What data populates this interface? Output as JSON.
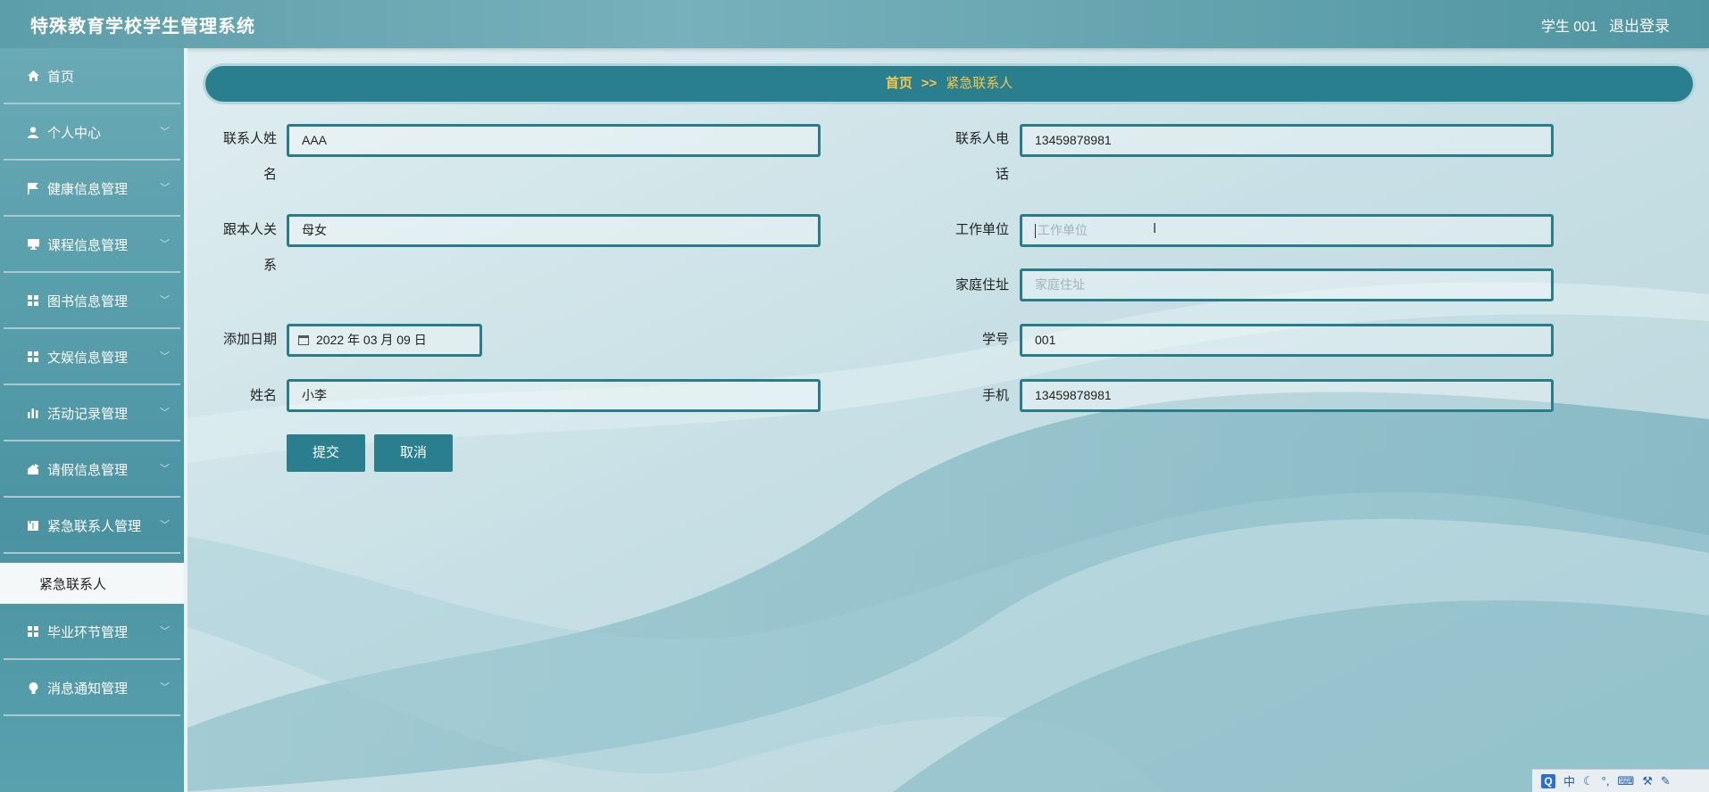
{
  "header": {
    "title": "特殊教育学校学生管理系统",
    "user": "学生  001",
    "logout": "退出登录"
  },
  "sidebar": {
    "items": [
      {
        "label": "首页",
        "icon": "home-icon"
      },
      {
        "label": "个人中心",
        "icon": "user-icon"
      },
      {
        "label": "健康信息管理",
        "icon": "flag-icon"
      },
      {
        "label": "课程信息管理",
        "icon": "monitor-icon"
      },
      {
        "label": "图书信息管理",
        "icon": "grid-icon"
      },
      {
        "label": "文娱信息管理",
        "icon": "grid-icon"
      },
      {
        "label": "活动记录管理",
        "icon": "bar-chart-icon"
      },
      {
        "label": "请假信息管理",
        "icon": "home-share-icon"
      },
      {
        "label": "紧急联系人管理",
        "icon": "book-icon"
      },
      {
        "label": "紧急联系人",
        "active": true
      },
      {
        "label": "毕业环节管理",
        "icon": "grid-icon"
      },
      {
        "label": "消息通知管理",
        "icon": "bulb-icon"
      }
    ]
  },
  "breadcrumb": {
    "home": "首页",
    "separator": ">>",
    "current": "紧急联系人"
  },
  "form": {
    "contact_name_label": "联系人姓名",
    "contact_name_value": "AAA",
    "contact_phone_label": "联系人电话",
    "contact_phone_value": "13459878981",
    "relation_label": "跟本人关系",
    "relation_value": "母女",
    "work_unit_label": "工作单位",
    "work_unit_placeholder": "工作单位",
    "home_address_label": "家庭住址",
    "home_address_placeholder": "家庭住址",
    "add_date_label": "添加日期",
    "add_date_value": "2022 年 03 月 09 日",
    "student_no_label": "学号",
    "student_no_value": "001",
    "name_label": "姓名",
    "name_value": "小李",
    "mobile_label": "手机",
    "mobile_value": "13459878981",
    "submit": "提交",
    "cancel": "取消"
  },
  "tray": {
    "q": "Q",
    "ime": "中",
    "icons": [
      "moon-icon",
      "punct-icon",
      "keyboard-icon",
      "tool-icon",
      "wrench-icon"
    ]
  }
}
